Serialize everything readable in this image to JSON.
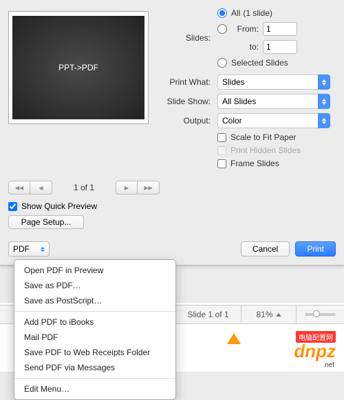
{
  "preview_text": "PPT->PDF",
  "slides": {
    "label": "Slides:",
    "all_label": "All",
    "count_label": "(1 slide)",
    "from_label": "From:",
    "to_label": "to:",
    "from_value": "1",
    "to_value": "1",
    "selected_label": "Selected Slides"
  },
  "print_what": {
    "label": "Print What:",
    "value": "Slides"
  },
  "slide_show": {
    "label": "Slide Show:",
    "value": "All Slides"
  },
  "output": {
    "label": "Output:",
    "value": "Color"
  },
  "checks": {
    "scale": "Scale to Fit Paper",
    "hidden": "Print Hidden Slides",
    "frame": "Frame Slides"
  },
  "pager": {
    "indicator": "1 of 1"
  },
  "quick_preview_label": "Show Quick Preview",
  "page_setup_label": "Page Setup...",
  "pdf_label": "PDF",
  "cancel_label": "Cancel",
  "print_label": "Print",
  "dropdown": {
    "open_preview": "Open PDF in Preview",
    "save_pdf": "Save as PDF…",
    "save_ps": "Save as PostScript…",
    "add_ibooks": "Add PDF to iBooks",
    "mail_pdf": "Mail PDF",
    "save_receipts": "Save PDF to Web Receipts Folder",
    "send_msgs": "Send PDF via Messages",
    "edit_menu": "Edit Menu…"
  },
  "status": {
    "slide": "Slide 1 of 1",
    "zoom": "81%"
  },
  "branding": {
    "logo": "dnpz",
    "sub": ".net",
    "tag": "电脑配置网"
  }
}
